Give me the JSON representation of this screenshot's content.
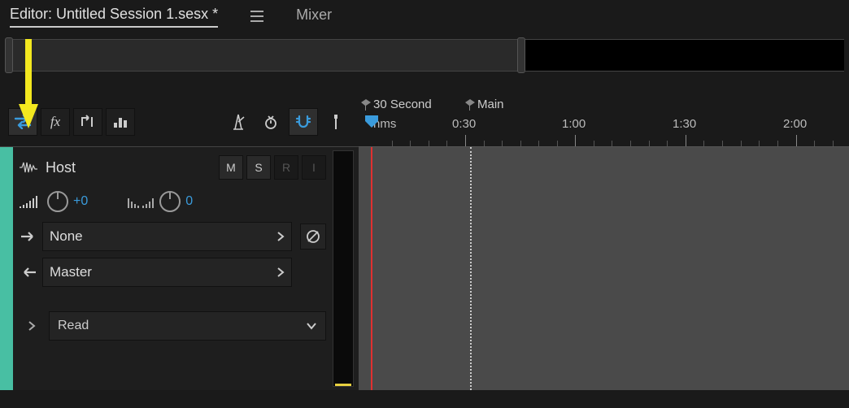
{
  "tabs": {
    "editor": "Editor: Untitled Session 1.sesx *",
    "mixer": "Mixer"
  },
  "markers": [
    {
      "label": "30 Second",
      "pos": 12
    },
    {
      "label": "Main",
      "pos": 140
    }
  ],
  "ruler": {
    "unit": "hms",
    "ticks": [
      {
        "label": "0:30",
        "pos": 127
      },
      {
        "label": "1:00",
        "pos": 262
      },
      {
        "label": "1:30",
        "pos": 398
      },
      {
        "label": "2:00",
        "pos": 534
      }
    ]
  },
  "track": {
    "name": "Host",
    "buttons": {
      "m": "M",
      "s": "S",
      "r": "R",
      "i": "I"
    },
    "volume": "+0",
    "pan": "0",
    "input": "None",
    "output": "Master",
    "automation": "Read"
  },
  "colors": {
    "accent": "#3a9bdc",
    "trackColor": "#48bfa3",
    "highlight": "#f3e81f"
  }
}
